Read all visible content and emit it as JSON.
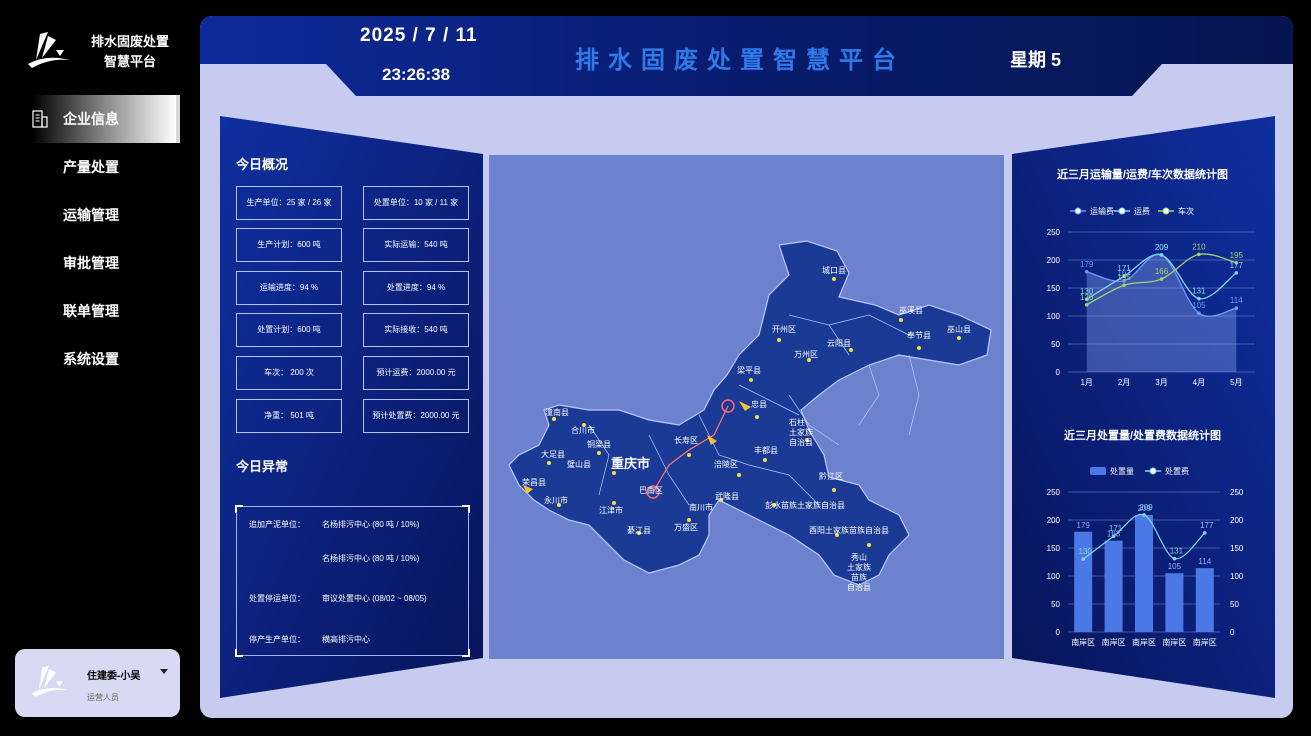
{
  "app": {
    "logo_line1": "排水固废处置",
    "logo_line2": "智慧平台"
  },
  "sidebar": {
    "items": [
      {
        "label": "企业信息",
        "active": true
      },
      {
        "label": "产量处置"
      },
      {
        "label": "运输管理"
      },
      {
        "label": "审批管理"
      },
      {
        "label": "联单管理"
      },
      {
        "label": "系统设置"
      }
    ]
  },
  "user": {
    "name": "住建委-小吴",
    "role": "运营人员"
  },
  "header": {
    "date": "2025 / 7 / 11",
    "time": "23:26:38",
    "title": "排水固废处置智慧平台",
    "weekday": "星期 5"
  },
  "overview": {
    "title": "今日概况",
    "stats": [
      "生产单位：25 家 / 26 家",
      "处置单位：10 家 / 11 家",
      "生产计划：600 吨",
      "实际运输：540 吨",
      "运输进度：94 %",
      "处置进度：94 %",
      "处置计划：600 吨",
      "实际接收：540 吨",
      "车次：  200 次",
      "预计运费：2000.00 元",
      "净重：  501 吨",
      "预计处置费：2000.00 元"
    ]
  },
  "anomaly": {
    "title": "今日异常",
    "rows": [
      {
        "label": "追加产泥单位：",
        "value": "名杨排污中心   (80 吨 / 10%)"
      },
      {
        "label": "",
        "value": "名杨排污中心   (80 吨 / 10%)"
      },
      {
        "label": "处置停运单位：",
        "value": "审议处置中心   (08/02 ~ 08/05)"
      },
      {
        "label": "停产生产单位：",
        "value": "横高排污中心"
      }
    ]
  },
  "map": {
    "center_label": "重庆市",
    "districts": [
      "城口县",
      "巫溪县",
      "开州区",
      "巫山县",
      "云阳县",
      "奉节县",
      "万州区",
      "梁平县",
      "垫江县",
      "忠县",
      "石柱土家族自治县",
      "长寿区",
      "丰都县",
      "涪陵区",
      "武隆县",
      "黔江区",
      "酉阳土家族苗族自治县",
      "秀山土家族苗族自治县",
      "彭水苗族土家族自治县",
      "南川市",
      "綦江县",
      "万盛区",
      "江津市",
      "巴南区",
      "永川市",
      "荣昌县",
      "大足县",
      "铜梁县",
      "璧山县",
      "合川市",
      "潼南县"
    ]
  },
  "colors": {
    "accent": "#2f79e8",
    "panel": "#0d2a8a",
    "main_bg": "#c6cbef",
    "map_bg": "#6c82cf"
  },
  "chart_data": [
    {
      "type": "line",
      "title": "近三月运输量/运费/车次数据统计图",
      "categories": [
        "1月",
        "2月",
        "3月",
        "4月",
        "5月"
      ],
      "ylim": [
        0,
        250
      ],
      "yticks": [
        0,
        50,
        100,
        150,
        200,
        250
      ],
      "legend": "top",
      "series": [
        {
          "name": "运输费",
          "values": [
            179,
            163,
            209,
            105,
            114
          ],
          "color": "#6f9bff"
        },
        {
          "name": "运费",
          "values": [
            130,
            171,
            209,
            131,
            177
          ],
          "color": "#7fd6e8"
        },
        {
          "name": "车次",
          "values": [
            120,
            155,
            166,
            210,
            195
          ],
          "color": "#a4d36b"
        }
      ]
    },
    {
      "type": "bar",
      "title": "近三月处置量/处置费数据统计图",
      "categories": [
        "南岸区",
        "南岸区",
        "南岸区",
        "南岸区",
        "南岸区"
      ],
      "ylim": [
        0,
        250
      ],
      "yticks": [
        0,
        50,
        100,
        150,
        200,
        250
      ],
      "legend": "top",
      "series": [
        {
          "name": "处置量",
          "type": "bar",
          "values": [
            179,
            163,
            209,
            105,
            114
          ],
          "color": "#4a78e6"
        },
        {
          "name": "处置费",
          "type": "line",
          "values": [
            130,
            171,
            209,
            131,
            177
          ],
          "color": "#7fd6e8"
        }
      ]
    }
  ]
}
